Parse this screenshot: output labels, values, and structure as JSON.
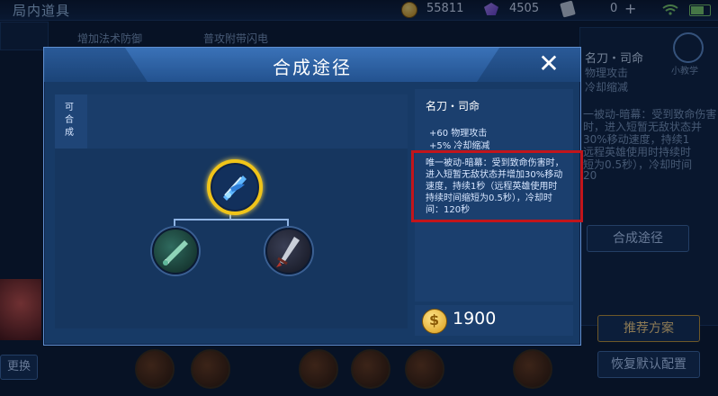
{
  "top_bar": {
    "title": "局内道具",
    "gold": "55811",
    "gems": "4505",
    "cards": "0"
  },
  "background": {
    "item_name": "名刀・司命",
    "stat1": "物理攻击",
    "stat2": "冷却缩减",
    "desc_lines": [
      "一被动-暗幕：受到致命伤害",
      "时，进入短暂无敌状态并",
      "30%移动速度，持续1",
      "远程英雄使用时持续时",
      "短为0.5秒），冷却时间",
      "20"
    ],
    "tutorial_label": "小教学",
    "compose_button": "合成途径",
    "recommend_button": "推荐方案",
    "reset_button": "恢复默认配置",
    "replace_button": "更换",
    "item_top_left": "增加法术防御",
    "item_top_right": "普攻附带闪电"
  },
  "dialog": {
    "title": "合成途径",
    "close": "✕",
    "tag": "可合成",
    "item": {
      "name": "名刀・司命",
      "stats": [
        "+60 物理攻击",
        "+5% 冷却缩减"
      ],
      "passive": "唯一被动-暗幕：受到致命伤害时，进入短暂无敌状态并增加30%移动速度，持续1秒（远程英雄使用时持续时间缩短为0.5秒），冷却时间：120秒",
      "price": "1900"
    },
    "tree": {
      "root_icon": "blade-of-destiny-icon",
      "child_icons": [
        "green-sword-icon",
        "dark-dagger-icon"
      ]
    }
  },
  "colors": {
    "accent": "#f0c419",
    "highlight": "#c2151b"
  }
}
